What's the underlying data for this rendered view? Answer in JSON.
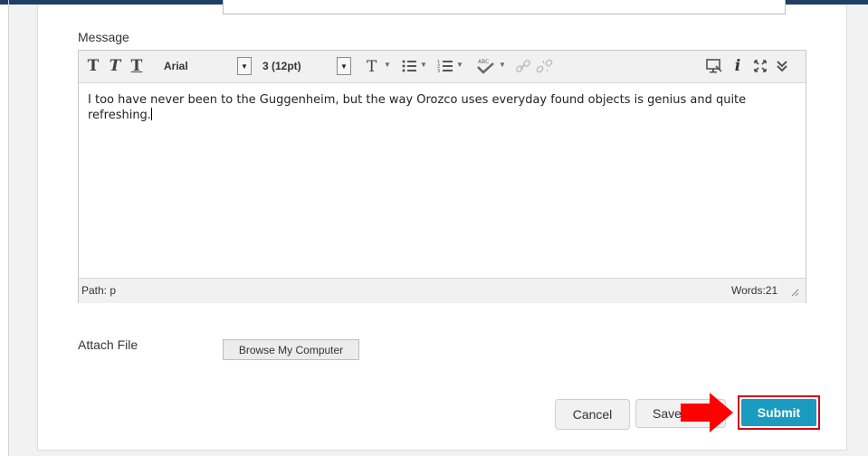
{
  "editor": {
    "label": "Message",
    "toolbar": {
      "bold": "T",
      "italic": "T",
      "underline": "T",
      "font_family": "Arial",
      "font_size": "3 (12pt)"
    },
    "content_text": "I too have never been to the Guggenheim, but the way Orozco uses everyday found objects is genius and quite refreshing.",
    "status_path": "Path: p",
    "word_count": "Words:21"
  },
  "attach": {
    "label": "Attach File",
    "browse_label": "Browse My Computer"
  },
  "actions": {
    "cancel_label": "Cancel",
    "save_label": "Save",
    "submit_label": "Submit"
  },
  "colors": {
    "submit": "#1b9bbf",
    "highlight": "#d0021b",
    "arrow": "#ff0000"
  }
}
